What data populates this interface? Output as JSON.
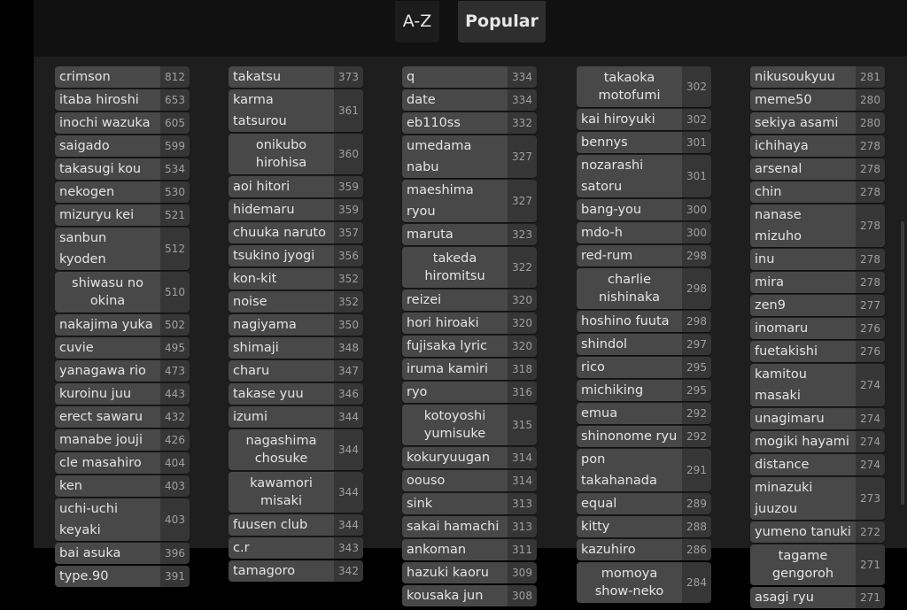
{
  "tabs": [
    {
      "label": "A-Z",
      "active": false
    },
    {
      "label": "Popular",
      "active": true
    }
  ],
  "columns": [
    [
      {
        "name": "crimson",
        "count": "812"
      },
      {
        "name": "itaba hiroshi",
        "count": "653"
      },
      {
        "name": "inochi wazuka",
        "count": "605"
      },
      {
        "name": "saigado",
        "count": "599"
      },
      {
        "name": "takasugi kou",
        "count": "534"
      },
      {
        "name": "nekogen",
        "count": "530"
      },
      {
        "name": "mizuryu kei",
        "count": "521"
      },
      {
        "name": "sanbun kyoden",
        "count": "512"
      },
      {
        "name": "shiwasu no okina",
        "count": "510",
        "wrap": true
      },
      {
        "name": "nakajima yuka",
        "count": "502"
      },
      {
        "name": "cuvie",
        "count": "495"
      },
      {
        "name": "yanagawa rio",
        "count": "473"
      },
      {
        "name": "kuroinu juu",
        "count": "443"
      },
      {
        "name": "erect sawaru",
        "count": "432"
      },
      {
        "name": "manabe jouji",
        "count": "426"
      },
      {
        "name": "cle masahiro",
        "count": "404"
      },
      {
        "name": "ken",
        "count": "403"
      },
      {
        "name": "uchi-uchi keyaki",
        "count": "403"
      },
      {
        "name": "bai asuka",
        "count": "396"
      },
      {
        "name": "type.90",
        "count": "391"
      }
    ],
    [
      {
        "name": "takatsu",
        "count": "373"
      },
      {
        "name": "karma tatsurou",
        "count": "361"
      },
      {
        "name": "onikubo hirohisa",
        "count": "360",
        "wrap": true
      },
      {
        "name": "aoi hitori",
        "count": "359"
      },
      {
        "name": "hidemaru",
        "count": "359"
      },
      {
        "name": "chuuka naruto",
        "count": "357"
      },
      {
        "name": "tsukino jyogi",
        "count": "356"
      },
      {
        "name": "kon-kit",
        "count": "352"
      },
      {
        "name": "noise",
        "count": "352"
      },
      {
        "name": "nagiyama",
        "count": "350"
      },
      {
        "name": "shimaji",
        "count": "348"
      },
      {
        "name": "charu",
        "count": "347"
      },
      {
        "name": "takase yuu",
        "count": "346"
      },
      {
        "name": "izumi",
        "count": "344"
      },
      {
        "name": "nagashima chosuke",
        "count": "344",
        "wrap": true
      },
      {
        "name": "kawamori misaki",
        "count": "344",
        "wrap": true
      },
      {
        "name": "fuusen club",
        "count": "344"
      },
      {
        "name": "c.r",
        "count": "343"
      },
      {
        "name": "tamagoro",
        "count": "342"
      }
    ],
    [
      {
        "name": "q",
        "count": "334"
      },
      {
        "name": "date",
        "count": "334"
      },
      {
        "name": "eb110ss",
        "count": "332"
      },
      {
        "name": "umedama nabu",
        "count": "327"
      },
      {
        "name": "maeshima ryou",
        "count": "327"
      },
      {
        "name": "maruta",
        "count": "323"
      },
      {
        "name": "takeda hiromitsu",
        "count": "322",
        "wrap": true
      },
      {
        "name": "reizei",
        "count": "320"
      },
      {
        "name": "hori hiroaki",
        "count": "320"
      },
      {
        "name": "fujisaka lyric",
        "count": "320"
      },
      {
        "name": "iruma kamiri",
        "count": "318"
      },
      {
        "name": "ryo",
        "count": "316"
      },
      {
        "name": "kotoyoshi yumisuke",
        "count": "315",
        "wrap": true
      },
      {
        "name": "kokuryuugan",
        "count": "314"
      },
      {
        "name": "oouso",
        "count": "314"
      },
      {
        "name": "sink",
        "count": "313"
      },
      {
        "name": "sakai hamachi",
        "count": "313"
      },
      {
        "name": "ankoman",
        "count": "311"
      },
      {
        "name": "hazuki kaoru",
        "count": "309"
      },
      {
        "name": "kousaka jun",
        "count": "308"
      }
    ],
    [
      {
        "name": "takaoka motofumi",
        "count": "302",
        "wrap": true
      },
      {
        "name": "kai hiroyuki",
        "count": "302"
      },
      {
        "name": "bennys",
        "count": "301"
      },
      {
        "name": "nozarashi satoru",
        "count": "301"
      },
      {
        "name": "bang-you",
        "count": "300"
      },
      {
        "name": "mdo-h",
        "count": "300"
      },
      {
        "name": "red-rum",
        "count": "298"
      },
      {
        "name": "charlie nishinaka",
        "count": "298",
        "wrap": true
      },
      {
        "name": "hoshino fuuta",
        "count": "298"
      },
      {
        "name": "shindol",
        "count": "297"
      },
      {
        "name": "rico",
        "count": "295"
      },
      {
        "name": "michiking",
        "count": "295"
      },
      {
        "name": "emua",
        "count": "292"
      },
      {
        "name": "shinonome ryu",
        "count": "292"
      },
      {
        "name": "pon takahanada",
        "count": "291"
      },
      {
        "name": "equal",
        "count": "289"
      },
      {
        "name": "kitty",
        "count": "288"
      },
      {
        "name": "kazuhiro",
        "count": "286"
      },
      {
        "name": "momoya show-neko",
        "count": "284",
        "wrap": true
      }
    ],
    [
      {
        "name": "nikusoukyuu",
        "count": "281"
      },
      {
        "name": "meme50",
        "count": "280"
      },
      {
        "name": "sekiya asami",
        "count": "280"
      },
      {
        "name": "ichihaya",
        "count": "278"
      },
      {
        "name": "arsenal",
        "count": "278"
      },
      {
        "name": "chin",
        "count": "278"
      },
      {
        "name": "nanase mizuho",
        "count": "278"
      },
      {
        "name": "inu",
        "count": "278"
      },
      {
        "name": "mira",
        "count": "278"
      },
      {
        "name": "zen9",
        "count": "277"
      },
      {
        "name": "inomaru",
        "count": "276"
      },
      {
        "name": "fuetakishi",
        "count": "276"
      },
      {
        "name": "kamitou masaki",
        "count": "274"
      },
      {
        "name": "unagimaru",
        "count": "274"
      },
      {
        "name": "mogiki hayami",
        "count": "274"
      },
      {
        "name": "distance",
        "count": "274"
      },
      {
        "name": "minazuki juuzou",
        "count": "273"
      },
      {
        "name": "yumeno tanuki",
        "count": "272"
      },
      {
        "name": "tagame gengoroh",
        "count": "271",
        "wrap": true
      },
      {
        "name": "asagi ryu",
        "count": "271"
      }
    ]
  ]
}
